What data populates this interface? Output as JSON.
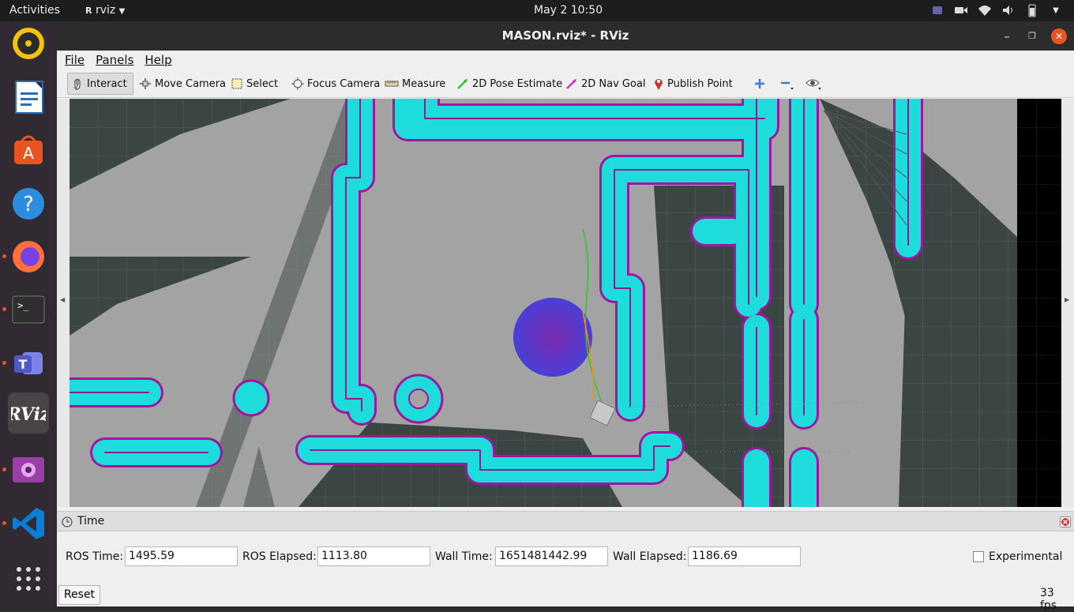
{
  "topbar": {
    "activities": "Activities",
    "app_name": "rviz",
    "clock": "May 2  10:50"
  },
  "window": {
    "title": "MASON.rviz* - RViz"
  },
  "menu": [
    "File",
    "Panels",
    "Help"
  ],
  "toolbar": {
    "interact": "Interact",
    "move_camera": "Move Camera",
    "select": "Select",
    "focus_camera": "Focus Camera",
    "measure": "Measure",
    "pose_estimate": "2D Pose Estimate",
    "nav_goal": "2D Nav Goal",
    "publish_point": "Publish Point"
  },
  "time_panel": {
    "title": "Time",
    "ros_time_label": "ROS Time:",
    "ros_time": "1495.59",
    "ros_elapsed_label": "ROS Elapsed:",
    "ros_elapsed": "1113.80",
    "wall_time_label": "Wall Time:",
    "wall_time": "1651481442.99",
    "wall_elapsed_label": "Wall Elapsed:",
    "wall_elapsed": "1186.69",
    "experimental": "Experimental",
    "reset": "Reset",
    "fps": "33 fps"
  },
  "colors": {
    "costmap_cyan": "#1fdcdc",
    "obstacle_magenta": "#a0169e",
    "free_gray": "#a3a3a3",
    "unknown_dark": "#3b4543"
  }
}
